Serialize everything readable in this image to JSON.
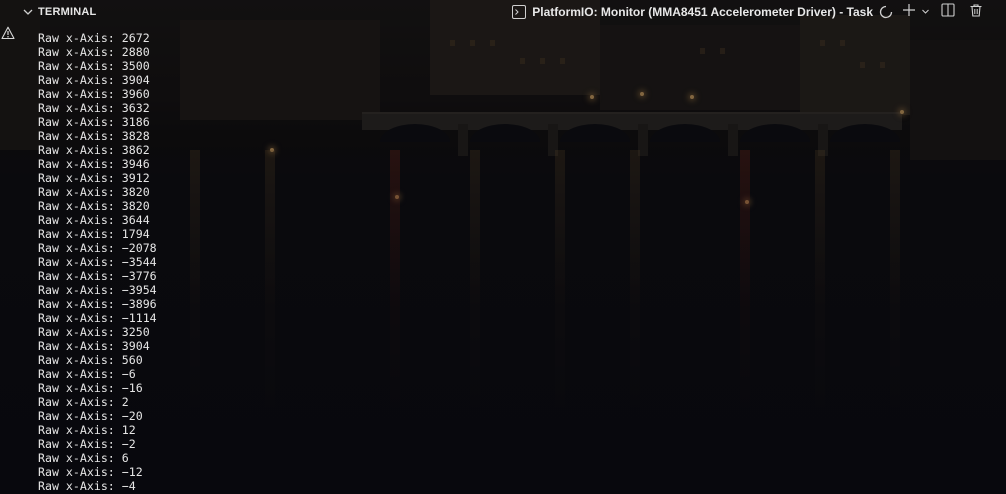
{
  "panel": {
    "title": "TERMINAL",
    "task_label": "PlatformIO: Monitor (MMA8451 Accelerometer Driver) - Task",
    "icons": {
      "collapse": "chevron-down-icon",
      "task": "terminal-icon",
      "running": "loading-spinner-icon",
      "new_terminal": "plus-icon",
      "dropdown": "chevron-down-icon",
      "split": "split-terminal-icon",
      "kill": "trash-icon"
    }
  },
  "gutter": {
    "icon": "warning-icon"
  },
  "terminal": {
    "lines": [
      "Raw x-Axis: 2672",
      "Raw x-Axis: 2880",
      "Raw x-Axis: 3500",
      "Raw x-Axis: 3904",
      "Raw x-Axis: 3960",
      "Raw x-Axis: 3632",
      "Raw x-Axis: 3186",
      "Raw x-Axis: 3828",
      "Raw x-Axis: 3862",
      "Raw x-Axis: 3946",
      "Raw x-Axis: 3912",
      "Raw x-Axis: 3820",
      "Raw x-Axis: 3820",
      "Raw x-Axis: 3644",
      "Raw x-Axis: 1794",
      "Raw x-Axis: −2078",
      "Raw x-Axis: −3544",
      "Raw x-Axis: −3776",
      "Raw x-Axis: −3954",
      "Raw x-Axis: −3896",
      "Raw x-Axis: −1114",
      "Raw x-Axis: 3250",
      "Raw x-Axis: 3904",
      "Raw x-Axis: 560",
      "Raw x-Axis: −6",
      "Raw x-Axis: −16",
      "Raw x-Axis: 2",
      "Raw x-Axis: −20",
      "Raw x-Axis: 12",
      "Raw x-Axis: −2",
      "Raw x-Axis: 6",
      "Raw x-Axis: −12",
      "Raw x-Axis: −4"
    ]
  },
  "colors": {
    "text": "#e6e6e6",
    "background": "#0b0d12",
    "warning": "#d8d8d8"
  }
}
